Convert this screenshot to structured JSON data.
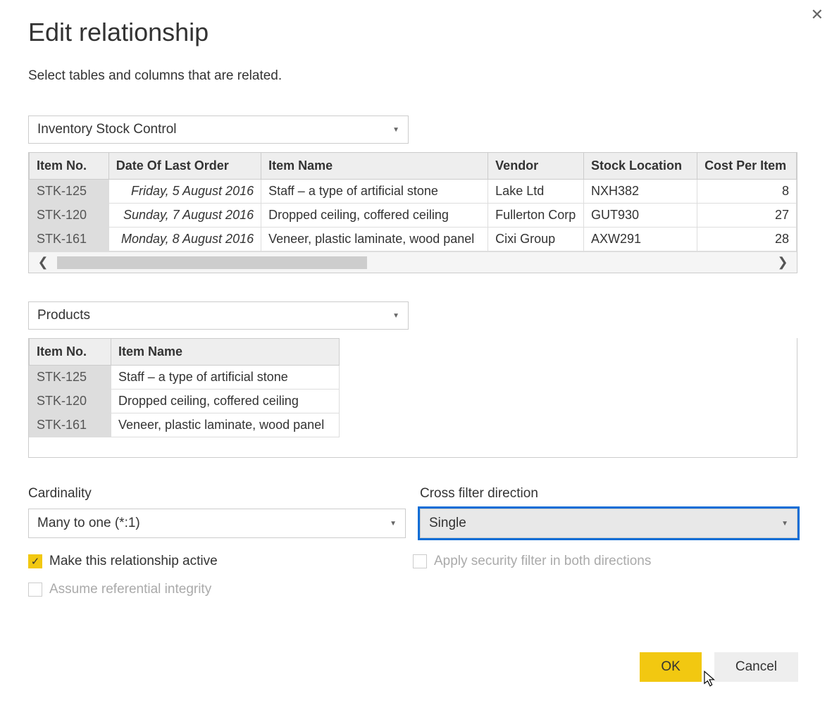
{
  "dialog": {
    "title": "Edit relationship",
    "subtitle": "Select tables and columns that are related."
  },
  "table1": {
    "dropdown": "Inventory Stock Control",
    "headers": [
      "Item No.",
      "Date Of Last Order",
      "Item Name",
      "Vendor",
      "Stock Location",
      "Cost Per Item"
    ],
    "rows": [
      {
        "c0": "STK-125",
        "c1": "Friday, 5 August 2016",
        "c2": "Staff – a type of artificial stone",
        "c3": "Lake Ltd",
        "c4": "NXH382",
        "c5": "8"
      },
      {
        "c0": "STK-120",
        "c1": "Sunday, 7 August 2016",
        "c2": "Dropped ceiling, coffered ceiling",
        "c3": "Fullerton Corp",
        "c4": "GUT930",
        "c5": "27"
      },
      {
        "c0": "STK-161",
        "c1": "Monday, 8 August 2016",
        "c2": "Veneer, plastic laminate, wood panel",
        "c3": "Cixi Group",
        "c4": "AXW291",
        "c5": "28"
      }
    ]
  },
  "table2": {
    "dropdown": "Products",
    "headers": [
      "Item No.",
      "Item Name"
    ],
    "rows": [
      {
        "c0": "STK-125",
        "c1": "Staff – a type of artificial stone"
      },
      {
        "c0": "STK-120",
        "c1": "Dropped ceiling, coffered ceiling"
      },
      {
        "c0": "STK-161",
        "c1": "Veneer, plastic laminate, wood panel"
      }
    ]
  },
  "options": {
    "cardinality_label": "Cardinality",
    "cardinality_value": "Many to one (*:1)",
    "crossfilter_label": "Cross filter direction",
    "crossfilter_value": "Single"
  },
  "checkboxes": {
    "active": "Make this relationship active",
    "referential": "Assume referential integrity",
    "security": "Apply security filter in both directions"
  },
  "buttons": {
    "ok": "OK",
    "cancel": "Cancel"
  }
}
